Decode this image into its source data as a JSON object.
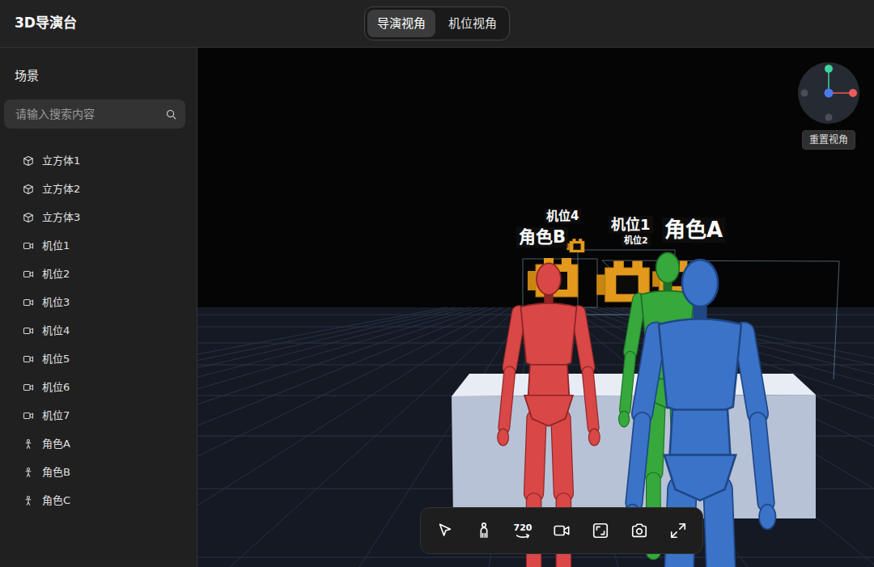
{
  "window": {
    "title": "3D导演台"
  },
  "tabs": [
    {
      "label": "导演视角",
      "selected": true
    },
    {
      "label": "机位视角",
      "selected": false
    }
  ],
  "sidebar": {
    "heading": "场景",
    "search": {
      "placeholder": "请输入搜索内容"
    },
    "items": [
      {
        "label": "立方体1",
        "kind": "cube"
      },
      {
        "label": "立方体2",
        "kind": "cube"
      },
      {
        "label": "立方体3",
        "kind": "cube"
      },
      {
        "label": "机位1",
        "kind": "camera"
      },
      {
        "label": "机位2",
        "kind": "camera"
      },
      {
        "label": "机位3",
        "kind": "camera"
      },
      {
        "label": "机位4",
        "kind": "camera"
      },
      {
        "label": "机位5",
        "kind": "camera"
      },
      {
        "label": "机位6",
        "kind": "camera"
      },
      {
        "label": "机位7",
        "kind": "camera"
      },
      {
        "label": "角色A",
        "kind": "person"
      },
      {
        "label": "角色B",
        "kind": "person"
      },
      {
        "label": "角色C",
        "kind": "person"
      }
    ]
  },
  "viewport": {
    "labels": [
      {
        "text": "角色B"
      },
      {
        "text": "机位4"
      },
      {
        "text": "机位1"
      },
      {
        "text": "机位2"
      },
      {
        "text": "角色A"
      }
    ],
    "reset_button": "重置视角"
  },
  "toolbar": {
    "tools": [
      {
        "kind": "select"
      },
      {
        "kind": "person"
      },
      {
        "kind": "pano",
        "text": "720"
      },
      {
        "kind": "camera"
      },
      {
        "kind": "frame"
      },
      {
        "kind": "snapshot"
      },
      {
        "kind": "fullscreen"
      }
    ]
  }
}
